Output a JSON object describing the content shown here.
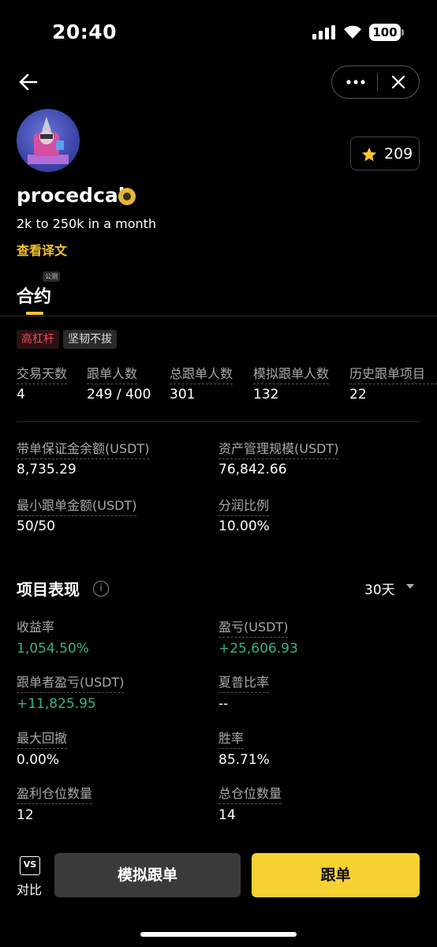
{
  "status_bar": {
    "time": "20:40",
    "battery": "100"
  },
  "profile": {
    "username": "procedcal",
    "bio": "2k to 250k in a month",
    "translate_link": "查看译文",
    "favorites_count": "209"
  },
  "tabs": [
    {
      "label": "合约",
      "badge": "公测"
    }
  ],
  "tags": [
    "高杠杆",
    "坚韧不拔"
  ],
  "stats": [
    {
      "label": "交易天数",
      "value": "4"
    },
    {
      "label": "跟单人数",
      "value": "249 / 400"
    },
    {
      "label": "总跟单人数",
      "value": "301"
    },
    {
      "label": "模拟跟单人数",
      "value": "132"
    },
    {
      "label": "历史跟单项目",
      "value": "22"
    }
  ],
  "account": [
    {
      "label": "带单保证金余额(USDT)",
      "value": "8,735.29"
    },
    {
      "label": "资产管理规模(USDT)",
      "value": "76,842.66"
    },
    {
      "label": "最小跟单金额(USDT)",
      "value": "50/50"
    },
    {
      "label": "分润比例",
      "value": "10.00%"
    }
  ],
  "performance": {
    "title": "项目表现",
    "period": "30天",
    "items": [
      {
        "label": "收益率",
        "value": "1,054.50%",
        "color": "#36b37e"
      },
      {
        "label": "盈亏(USDT)",
        "value": "+25,606.93",
        "color": "#36b37e"
      },
      {
        "label": "跟单者盈亏(USDT)",
        "value": "+11,825.95",
        "color": "#36b37e"
      },
      {
        "label": "夏普比率",
        "value": "--"
      },
      {
        "label": "最大回撤",
        "value": "0.00%"
      },
      {
        "label": "胜率",
        "value": "85.71%"
      },
      {
        "label": "盈利仓位数量",
        "value": "12"
      },
      {
        "label": "总仓位数量",
        "value": "14"
      }
    ]
  },
  "bottom_bar": {
    "compare_icon": "VS",
    "compare_label": "对比",
    "simulate_button": "模拟跟单",
    "copy_button": "跟单"
  },
  "colors": {
    "accent": "#f7d131",
    "positive": "#36b37e",
    "danger": "#ea4a52"
  }
}
